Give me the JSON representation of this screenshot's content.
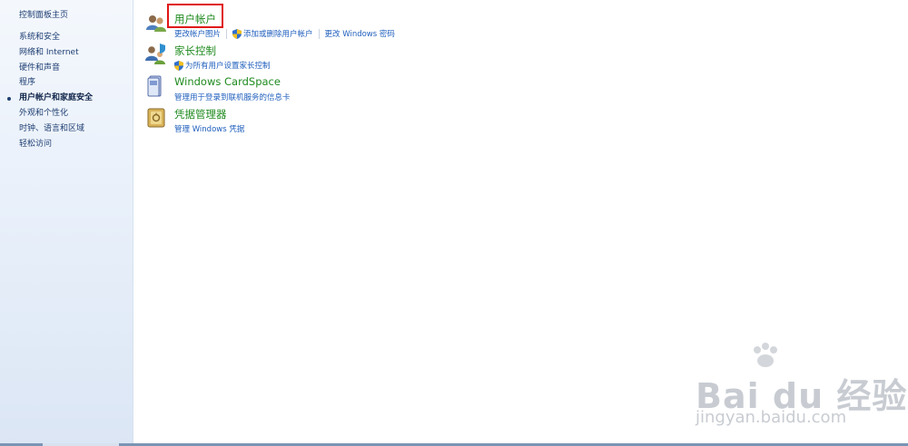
{
  "sidebar": {
    "home": "控制面板主页",
    "items": [
      {
        "label": "系统和安全"
      },
      {
        "label": "网络和 Internet"
      },
      {
        "label": "硬件和声音"
      },
      {
        "label": "程序"
      },
      {
        "label": "用户帐户和家庭安全"
      },
      {
        "label": "外观和个性化"
      },
      {
        "label": "时钟、语言和区域"
      },
      {
        "label": "轻松访问"
      }
    ]
  },
  "categories": [
    {
      "title": "用户帐户",
      "icon": "user-accounts-icon",
      "links": [
        "更改帐户图片",
        "添加或删除用户帐户",
        "更改 Windows 密码"
      ]
    },
    {
      "title": "家长控制",
      "icon": "parental-controls-icon",
      "links": [
        "为所有用户设置家长控制"
      ]
    },
    {
      "title": "Windows CardSpace",
      "icon": "cardspace-icon",
      "links": [
        "管理用于登录到联机服务的信息卡"
      ]
    },
    {
      "title": "凭据管理器",
      "icon": "credential-manager-icon",
      "links": [
        "管理 Windows 凭据"
      ]
    }
  ],
  "watermark": {
    "brand": "Bai du 经验",
    "url": "jingyan.baidu.com"
  },
  "colors": {
    "title": "#1e8a1e",
    "link": "#1f5fbd",
    "highlight": "#e01515",
    "sidebar_text": "#1e3e72"
  }
}
